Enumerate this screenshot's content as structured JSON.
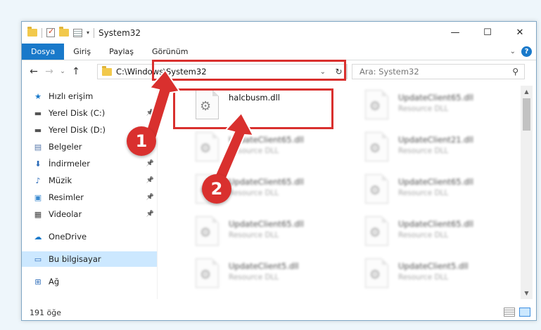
{
  "window": {
    "title": "System32",
    "controls": {
      "minimize": "—",
      "maximize": "☐",
      "close": "✕"
    }
  },
  "ribbon": {
    "tabs": [
      "Dosya",
      "Giriş",
      "Paylaş",
      "Görünüm"
    ],
    "help": "?"
  },
  "nav": {
    "back": "←",
    "forward": "→",
    "recent": "⌄",
    "up": "↑",
    "address": "C:\\Windows\\System32",
    "search_placeholder": "Ara: System32"
  },
  "sidebar": {
    "items": [
      {
        "label": "Hızlı erişim",
        "icon": "star-icon",
        "glyph": "★",
        "color": "#1979ca"
      },
      {
        "label": "Yerel Disk (C:)",
        "icon": "drive-icon",
        "glyph": "▬",
        "color": "#555",
        "pinned": true
      },
      {
        "label": "Yerel Disk (D:)",
        "icon": "drive-icon",
        "glyph": "▬",
        "color": "#555",
        "pinned": true
      },
      {
        "label": "Belgeler",
        "icon": "documents-icon",
        "glyph": "▤",
        "color": "#5577aa",
        "pinned": true
      },
      {
        "label": "İndirmeler",
        "icon": "downloads-icon",
        "glyph": "⬇",
        "color": "#2a6ab8",
        "pinned": true
      },
      {
        "label": "Müzik",
        "icon": "music-icon",
        "glyph": "♪",
        "color": "#2a6ab8",
        "pinned": true
      },
      {
        "label": "Resimler",
        "icon": "pictures-icon",
        "glyph": "▣",
        "color": "#3a8ad0",
        "pinned": true
      },
      {
        "label": "Videolar",
        "icon": "videos-icon",
        "glyph": "▦",
        "color": "#444",
        "pinned": true
      },
      {
        "label": "OneDrive",
        "icon": "cloud-icon",
        "glyph": "☁",
        "color": "#1979ca"
      },
      {
        "label": "Bu bilgisayar",
        "icon": "computer-icon",
        "glyph": "▭",
        "color": "#2a6ab8",
        "selected": true
      },
      {
        "label": "Ağ",
        "icon": "network-icon",
        "glyph": "⊞",
        "color": "#2a6ab8"
      }
    ]
  },
  "files": [
    {
      "name": "halcbusm.dll",
      "type": "",
      "blurred": false
    },
    {
      "name": "UpdateClient65.dll",
      "type": "Resource DLL",
      "blurred": true
    },
    {
      "name": "UpdateClient65.dll",
      "type": "Resource DLL",
      "blurred": true
    },
    {
      "name": "UpdateClient21.dll",
      "type": "Resource DLL",
      "blurred": true
    },
    {
      "name": "UpdateClient65.dll",
      "type": "Resource DLL",
      "blurred": true
    },
    {
      "name": "UpdateClient65.dll",
      "type": "Resource DLL",
      "blurred": true
    },
    {
      "name": "UpdateClient65.dll",
      "type": "Resource DLL",
      "blurred": true
    },
    {
      "name": "UpdateClient65.dll",
      "type": "Resource DLL",
      "blurred": true
    },
    {
      "name": "UpdateClient5.dll",
      "type": "Resource DLL",
      "blurred": true
    },
    {
      "name": "UpdateClient5.dll",
      "type": "Resource DLL",
      "blurred": true
    }
  ],
  "status": {
    "count": "191 öğe"
  },
  "callouts": [
    "1",
    "2"
  ],
  "colors": {
    "accent": "#1979ca",
    "highlight": "#d9302e",
    "selection": "#cce8ff"
  }
}
